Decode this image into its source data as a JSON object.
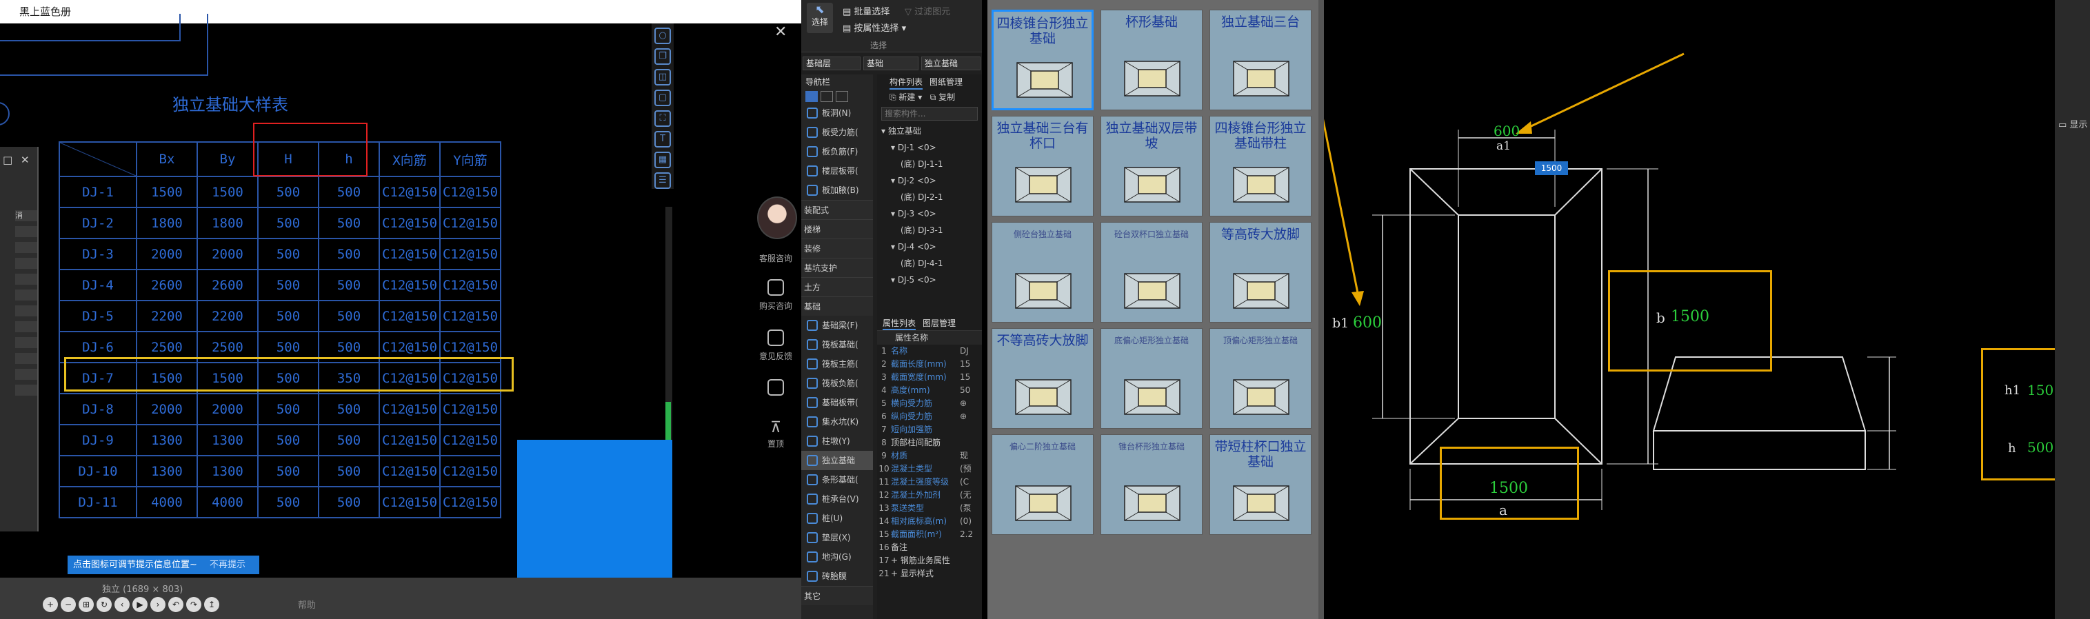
{
  "left_window": {
    "title": "黑上蓝色册",
    "drawing_title": "独立基础大样表",
    "table": {
      "headers": [
        "",
        "Bx",
        "By",
        "H",
        "h",
        "X向筋",
        "Y向筋"
      ],
      "rows": [
        [
          "DJ-1",
          "1500",
          "1500",
          "500",
          "500",
          "C12@150",
          "C12@150"
        ],
        [
          "DJ-2",
          "1800",
          "1800",
          "500",
          "500",
          "C12@150",
          "C12@150"
        ],
        [
          "DJ-3",
          "2000",
          "2000",
          "500",
          "500",
          "C12@150",
          "C12@150"
        ],
        [
          "DJ-4",
          "2600",
          "2600",
          "500",
          "500",
          "C12@150",
          "C12@150"
        ],
        [
          "DJ-5",
          "2200",
          "2200",
          "500",
          "500",
          "C12@150",
          "C12@150"
        ],
        [
          "DJ-6",
          "2500",
          "2500",
          "500",
          "500",
          "C12@150",
          "C12@150"
        ],
        [
          "DJ-7",
          "1500",
          "1500",
          "500",
          "350",
          "C12@150",
          "C12@150"
        ],
        [
          "DJ-8",
          "2000",
          "2000",
          "500",
          "500",
          "C12@150",
          "C12@150"
        ],
        [
          "DJ-9",
          "1300",
          "1300",
          "500",
          "500",
          "C12@150",
          "C12@150"
        ],
        [
          "DJ-10",
          "1300",
          "1300",
          "500",
          "500",
          "C12@150",
          "C12@150"
        ],
        [
          "DJ-11",
          "4000",
          "4000",
          "500",
          "500",
          "C12@150",
          "C12@150"
        ]
      ]
    },
    "hint_text": "点击图标可调节提示信息位置~",
    "hint_dismiss": "不再提示",
    "image_size_label": "独立 (1689 × 803)",
    "help_link": "帮助",
    "dialog_label": "消",
    "nav_controls": [
      "+",
      "−",
      "⊞",
      "↻",
      "‹",
      "▶",
      "›",
      "↶",
      "↷",
      "↥"
    ]
  },
  "service_panel": {
    "consult_label": "客服咨询",
    "ai_label": "购买咨询",
    "feedback_label": "意见反馈",
    "top_label": "置顶"
  },
  "ribbon": {
    "select_label": "选择",
    "batch_select": "批量选择",
    "filter_label": "过滤图元",
    "by_attr_select": "按属性选择",
    "section_label": "选择"
  },
  "combos": [
    "基础层",
    "基础",
    "独立基础"
  ],
  "nav": {
    "header": "导航栏",
    "group1": [
      {
        "label": "板洞(N)",
        "icon": "slab-hole-icon"
      },
      {
        "label": "板受力筋(",
        "icon": "slab-rebar-icon"
      },
      {
        "label": "板负筋(F)",
        "icon": "slab-neg-rebar-icon"
      },
      {
        "label": "楼层板带(",
        "icon": "floor-strip-icon"
      },
      {
        "label": "板加腋(B)",
        "icon": "slab-haunch-icon"
      }
    ],
    "cats": [
      "装配式",
      "楼梯",
      "装修",
      "基坑支护",
      "土方",
      "基础"
    ],
    "group2": [
      {
        "label": "基础梁(F)",
        "icon": "found-beam-icon"
      },
      {
        "label": "筏板基础(",
        "icon": "raft-icon"
      },
      {
        "label": "筏板主筋(",
        "icon": "raft-main-icon"
      },
      {
        "label": "筏板负筋(",
        "icon": "raft-neg-icon"
      },
      {
        "label": "基础板带(",
        "icon": "found-strip-icon"
      },
      {
        "label": "集水坑(K)",
        "icon": "sump-icon"
      },
      {
        "label": "柱墩(Y)",
        "icon": "pier-icon"
      },
      {
        "label": "独立基础",
        "icon": "isolated-found-icon"
      },
      {
        "label": "条形基础(",
        "icon": "strip-found-icon"
      },
      {
        "label": "桩承台(V)",
        "icon": "pile-cap-icon"
      },
      {
        "label": "桩(U)",
        "icon": "pile-icon"
      },
      {
        "label": "垫层(X)",
        "icon": "cushion-icon"
      },
      {
        "label": "地沟(G)",
        "icon": "trench-icon"
      },
      {
        "label": "砖胎膜",
        "icon": "brick-mold-icon"
      }
    ],
    "footer": "其它"
  },
  "component_list": {
    "tabs": [
      "构件列表",
      "图纸管理"
    ],
    "new_label": "新建",
    "copy_label": "复制",
    "search_placeholder": "搜索构件...",
    "tree": [
      {
        "label": "独立基础",
        "indent": 0
      },
      {
        "label": "DJ-1 <0>",
        "indent": 1
      },
      {
        "label": "(底) DJ-1-1",
        "indent": 2
      },
      {
        "label": "DJ-2 <0>",
        "indent": 1
      },
      {
        "label": "(底) DJ-2-1",
        "indent": 2
      },
      {
        "label": "DJ-3 <0>",
        "indent": 1
      },
      {
        "label": "(底) DJ-3-1",
        "indent": 2
      },
      {
        "label": "DJ-4 <0>",
        "indent": 1
      },
      {
        "label": "(底) DJ-4-1",
        "indent": 2
      },
      {
        "label": "DJ-5 <0>",
        "indent": 1
      }
    ]
  },
  "properties": {
    "tabs": [
      "属性列表",
      "图层管理"
    ],
    "header": "属性名称",
    "rows": [
      {
        "n": "1",
        "k": "名称",
        "v": "DJ",
        "blue": true
      },
      {
        "n": "2",
        "k": "截面长度(mm)",
        "v": "15",
        "blue": true
      },
      {
        "n": "3",
        "k": "截面宽度(mm)",
        "v": "15",
        "blue": true
      },
      {
        "n": "4",
        "k": "高度(mm)",
        "v": "50",
        "blue": true
      },
      {
        "n": "5",
        "k": "横向受力筋",
        "v": "⊕",
        "blue": true
      },
      {
        "n": "6",
        "k": "纵向受力筋",
        "v": "⊕",
        "blue": true
      },
      {
        "n": "7",
        "k": "短向加强筋",
        "v": "",
        "blue": true
      },
      {
        "n": "8",
        "k": "顶部柱间配筋",
        "v": "",
        "blue": false
      },
      {
        "n": "9",
        "k": "材质",
        "v": "现",
        "blue": true
      },
      {
        "n": "10",
        "k": "混凝土类型",
        "v": "(预",
        "blue": true
      },
      {
        "n": "11",
        "k": "混凝土强度等级",
        "v": "(C",
        "blue": true
      },
      {
        "n": "12",
        "k": "混凝土外加剂",
        "v": "(无",
        "blue": true
      },
      {
        "n": "13",
        "k": "泵送类型",
        "v": "(泵",
        "blue": true
      },
      {
        "n": "14",
        "k": "相对底标高(m)",
        "v": "(0)",
        "blue": true
      },
      {
        "n": "15",
        "k": "截面面积(m²)",
        "v": "2.2",
        "blue": true
      },
      {
        "n": "16",
        "k": "备注",
        "v": "",
        "blue": false
      },
      {
        "n": "17",
        "k": "+ 钢筋业务属性",
        "v": "",
        "blue": false
      },
      {
        "n": "21",
        "k": "+ 显示样式",
        "v": "",
        "blue": false
      }
    ]
  },
  "gallery": {
    "items": [
      {
        "label": "四棱锥台形独立基础",
        "small": false
      },
      {
        "label": "杯形基础",
        "small": false
      },
      {
        "label": "独立基础三台",
        "small": false
      },
      {
        "label": "独立基础三台有杯口",
        "small": false
      },
      {
        "label": "独立基础双层带坡",
        "small": false
      },
      {
        "label": "四棱锥台形独立基础带柱",
        "small": false
      },
      {
        "label": "侧砼台独立基础",
        "small": true
      },
      {
        "label": "砼台双杯口独立基础",
        "small": true
      },
      {
        "label": "等高砖大放脚",
        "small": false
      },
      {
        "label": "不等高砖大放脚",
        "small": false
      },
      {
        "label": "底偏心矩形独立基础",
        "small": true
      },
      {
        "label": "顶偏心矩形独立基础",
        "small": true
      },
      {
        "label": "偏心二阶独立基础",
        "small": true
      },
      {
        "label": "锥台杯形独立基础",
        "small": true
      },
      {
        "label": "带短柱杯口独立基础",
        "small": false
      }
    ]
  },
  "detail_drawing": {
    "a1_value": "600",
    "a1_label": "a1",
    "b1_label": "b1",
    "b1_value": "600",
    "b_label": "b",
    "b_value": "1500",
    "a_value": "1500",
    "a_label": "a",
    "tag_value": "1500",
    "h1_label": "h1",
    "h1_value": "150",
    "h_label": "h",
    "h_value": "500",
    "display_label": "显示"
  }
}
